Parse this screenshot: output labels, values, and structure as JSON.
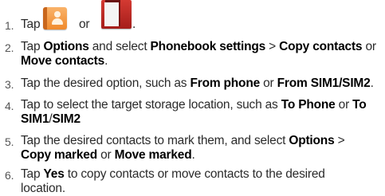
{
  "steps": [
    {
      "num": "1.",
      "tap": "Tap",
      "or": "or",
      "end": "."
    },
    {
      "num": "2.",
      "parts": [
        "Tap ",
        "Options",
        " and select ",
        "Phonebook settings",
        " > ",
        "Copy contacts",
        " or"
      ],
      "line2": [
        "Move contacts",
        "."
      ]
    },
    {
      "num": "3.",
      "parts": [
        "Tap the desired option, such as ",
        "From phone",
        " or ",
        "From SIM1/SIM2",
        "."
      ]
    },
    {
      "num": "4.",
      "parts": [
        "Tap to select the target storage location, such as ",
        "To Phone",
        " or ",
        "To"
      ],
      "line2": [
        "SIM1",
        "/",
        "SIM2"
      ]
    },
    {
      "num": "5.",
      "parts": [
        "Tap the desired contacts to mark them, and select ",
        "Options",
        " >"
      ],
      "line2": [
        "Copy marked",
        " or ",
        "Move marked",
        "."
      ]
    },
    {
      "num": "6.",
      "parts": [
        "Tap ",
        "Yes",
        " to copy contacts or move contacts to the desired"
      ],
      "line2": [
        "location."
      ]
    }
  ],
  "icons": {
    "first": "contacts-app-icon",
    "second": "notes-app-icon"
  }
}
